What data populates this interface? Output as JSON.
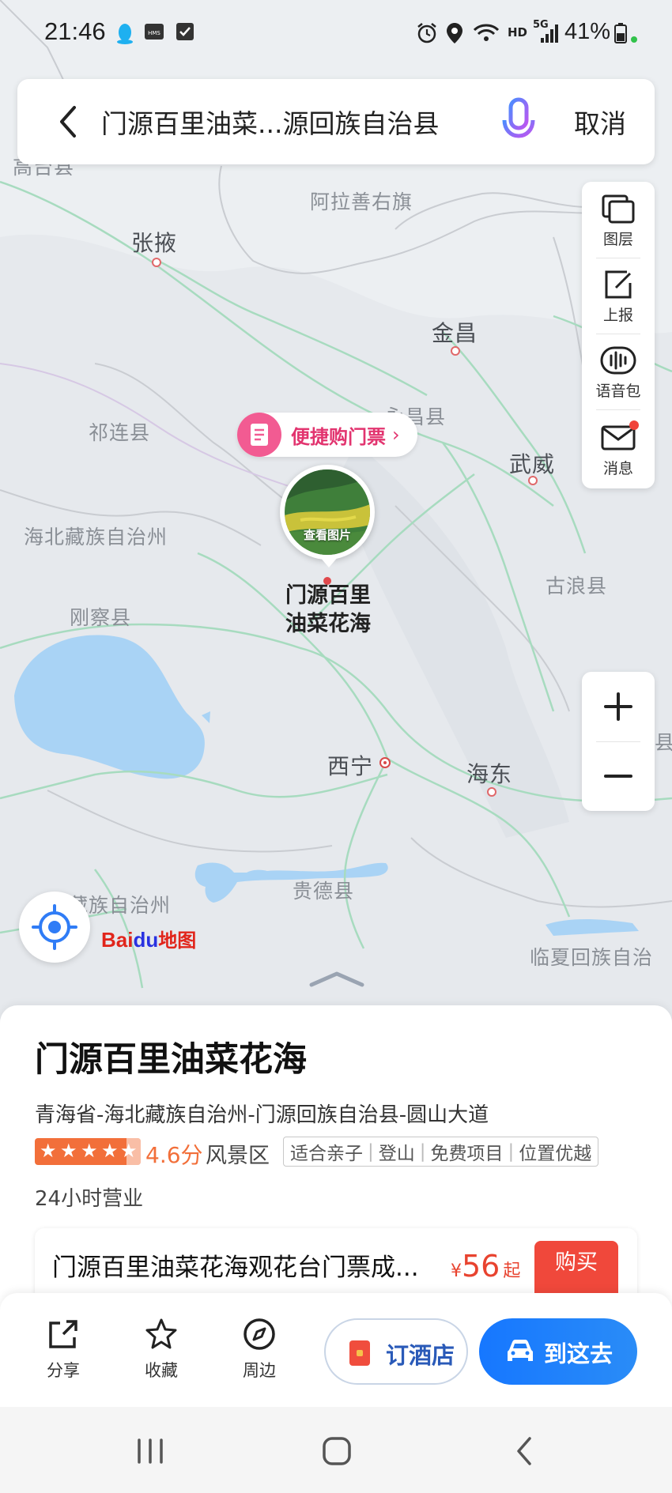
{
  "status_bar": {
    "time": "21:46",
    "network": "HD",
    "network_gen": "5G",
    "battery": "41%"
  },
  "search": {
    "query": "门源百里油菜...源回族自治县",
    "cancel_label": "取消"
  },
  "tools": [
    {
      "label": "图层",
      "icon": "layers-icon"
    },
    {
      "label": "上报",
      "icon": "report-icon"
    },
    {
      "label": "语音包",
      "icon": "voice-pack-icon"
    },
    {
      "label": "消息",
      "icon": "message-icon"
    }
  ],
  "zoom": {
    "in": "+",
    "out": "−"
  },
  "map_labels": {
    "gaotai": "高台县",
    "alashan": "阿拉善右旗",
    "zhangye": "张掖",
    "jinchang": "金昌",
    "yongchang": "永昌县",
    "qilian": "祁连县",
    "wuwei": "武威",
    "haibei": "海北藏族自治州",
    "gulang": "古浪县",
    "gangcha": "刚察县",
    "xining": "西宁",
    "haidong": "海东",
    "guide": "贵德县",
    "hainan": "藏族自治州",
    "linxia": "临夏回族自治",
    "edge": "县"
  },
  "ticket_pill": {
    "label": "便捷购门票"
  },
  "photo": {
    "caption": "查看图片"
  },
  "poi": {
    "name": "门源百里油菜花海"
  },
  "logo": {
    "part1": "Bai",
    "part2": "du",
    "part3": "地图"
  },
  "place": {
    "title": "门源百里油菜花海",
    "address": "青海省-海北藏族自治州-门源回族自治县-圆山大道",
    "rating": "4.6分",
    "rating_value": 4.6,
    "category": "风景区",
    "tags": [
      "适合亲子",
      "登山",
      "免费项目",
      "位置优越"
    ],
    "hours": "24小时营业"
  },
  "ticket_card": {
    "title": "门源百里油菜花海观花台门票成...",
    "currency": "¥",
    "price": "56",
    "price_suffix": "起",
    "buy_label": "购买"
  },
  "actions": {
    "share": "分享",
    "favorite": "收藏",
    "nearby": "周边",
    "hotel": "订酒店",
    "go": "到这去"
  },
  "colors": {
    "accent_blue": "#1677ff",
    "ticket_pink": "#e2346f",
    "price_red": "#e8432f",
    "rating_orange": "#f26f3a"
  }
}
